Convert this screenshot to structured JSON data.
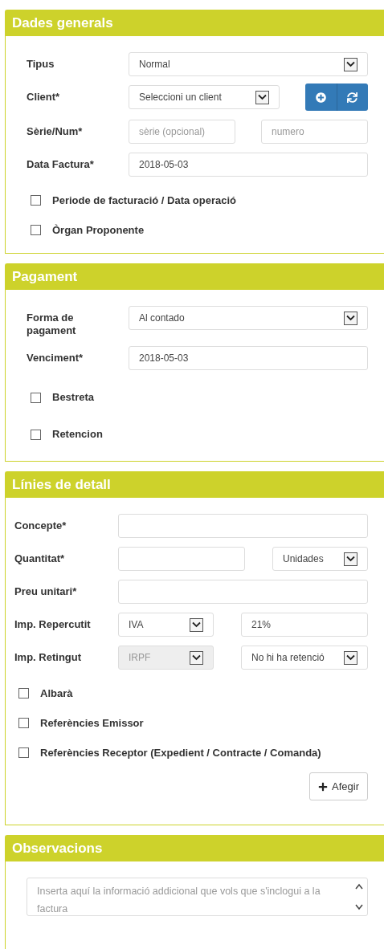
{
  "sections": [
    {
      "title": "Dades generals",
      "rows": [
        {
          "kind": "field",
          "label": "Tipus",
          "controls": [
            {
              "kind": "select",
              "value": "Normal",
              "disabled": false
            }
          ]
        },
        {
          "kind": "field",
          "label": "Client*",
          "controls": [
            {
              "kind": "select",
              "value": "Seleccioni un client",
              "disabled": false
            },
            {
              "kind": "buttons"
            }
          ]
        },
        {
          "kind": "field",
          "label": "Sèrie/Num*",
          "controls": [
            {
              "kind": "input",
              "placeholder": "sèrie (opcional)"
            },
            {
              "kind": "input",
              "placeholder": "numero"
            }
          ]
        },
        {
          "kind": "field",
          "label": "Data Factura*",
          "controls": [
            {
              "kind": "input",
              "value": "2018-05-03"
            }
          ]
        },
        {
          "kind": "checkbox",
          "label": "Periode de facturació / Data operació",
          "checked": false
        },
        {
          "kind": "checkbox",
          "label": "Òrgan Proponente",
          "checked": false
        }
      ]
    },
    {
      "title": "Pagament",
      "rows": [
        {
          "kind": "field",
          "label": "Forma de pagament",
          "controls": [
            {
              "kind": "select",
              "value": "Al contado",
              "disabled": false
            }
          ]
        },
        {
          "kind": "field",
          "label": "Venciment*",
          "controls": [
            {
              "kind": "input",
              "value": "2018-05-03"
            }
          ]
        },
        {
          "kind": "checkbox",
          "label": "Bestreta",
          "checked": false
        },
        {
          "kind": "checkbox",
          "label": "Retencion",
          "checked": false
        }
      ]
    },
    {
      "title": "Línies de detall",
      "rows": [
        {
          "kind": "field",
          "label": "Concepte*",
          "controls": [
            {
              "kind": "input"
            }
          ]
        },
        {
          "kind": "field",
          "label": "Quantitat*",
          "controls": [
            {
              "kind": "input"
            },
            {
              "kind": "select",
              "value": "Unidades",
              "disabled": false
            }
          ]
        },
        {
          "kind": "field",
          "label": "Preu unitari*",
          "controls": [
            {
              "kind": "input"
            }
          ]
        },
        {
          "kind": "field",
          "label": "Imp. Repercutit",
          "controls": [
            {
              "kind": "select",
              "value": "IVA",
              "disabled": false
            },
            {
              "kind": "input",
              "value": "21%"
            }
          ]
        },
        {
          "kind": "field",
          "label": "Imp. Retingut",
          "controls": [
            {
              "kind": "select",
              "value": "IRPF",
              "disabled": true
            },
            {
              "kind": "select",
              "value": "No hi ha retenció",
              "disabled": false
            }
          ]
        },
        {
          "kind": "checkbox",
          "label": "Albarà",
          "checked": false
        },
        {
          "kind": "checkbox",
          "label": "Referències Emissor",
          "checked": false
        },
        {
          "kind": "checkbox",
          "label": "Referències Receptor (Expedient / Contracte / Comanda)",
          "checked": false
        },
        {
          "kind": "action",
          "label": "Afegir"
        }
      ]
    },
    {
      "title": "Observacions",
      "rows": [
        {
          "kind": "textarea",
          "placeholder": "Inserta aquí la informació addicional que vols que s'inclogui a la factura"
        }
      ]
    }
  ]
}
